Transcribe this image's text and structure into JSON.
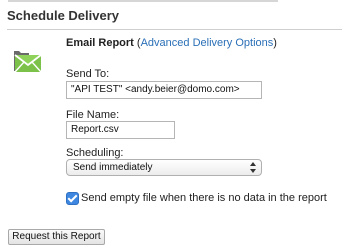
{
  "section": {
    "title": "Schedule Delivery"
  },
  "email_report": {
    "title": "Email Report",
    "paren_open": " (",
    "link_text": "Advanced Delivery Options",
    "paren_close": ")"
  },
  "send_to": {
    "label": "Send To:",
    "value": "\"API TEST\" <andy.beier@domo.com>"
  },
  "file_name": {
    "label": "File Name:",
    "value": "Report.csv"
  },
  "scheduling": {
    "label": "Scheduling:",
    "selected": "Send immediately"
  },
  "empty_file": {
    "checked": true,
    "label": "Send empty file when there is no data in the report"
  },
  "submit_button": {
    "label": "Request this Report"
  },
  "icons": {
    "email_icon": "email-envelope-icon",
    "select_arrows": "updown-arrows-icon",
    "checkbox": "checkmark-icon"
  },
  "colors": {
    "link": "#2a6fb7",
    "checkbox": "#3d87e0",
    "icon_green": "#7cc24a"
  }
}
